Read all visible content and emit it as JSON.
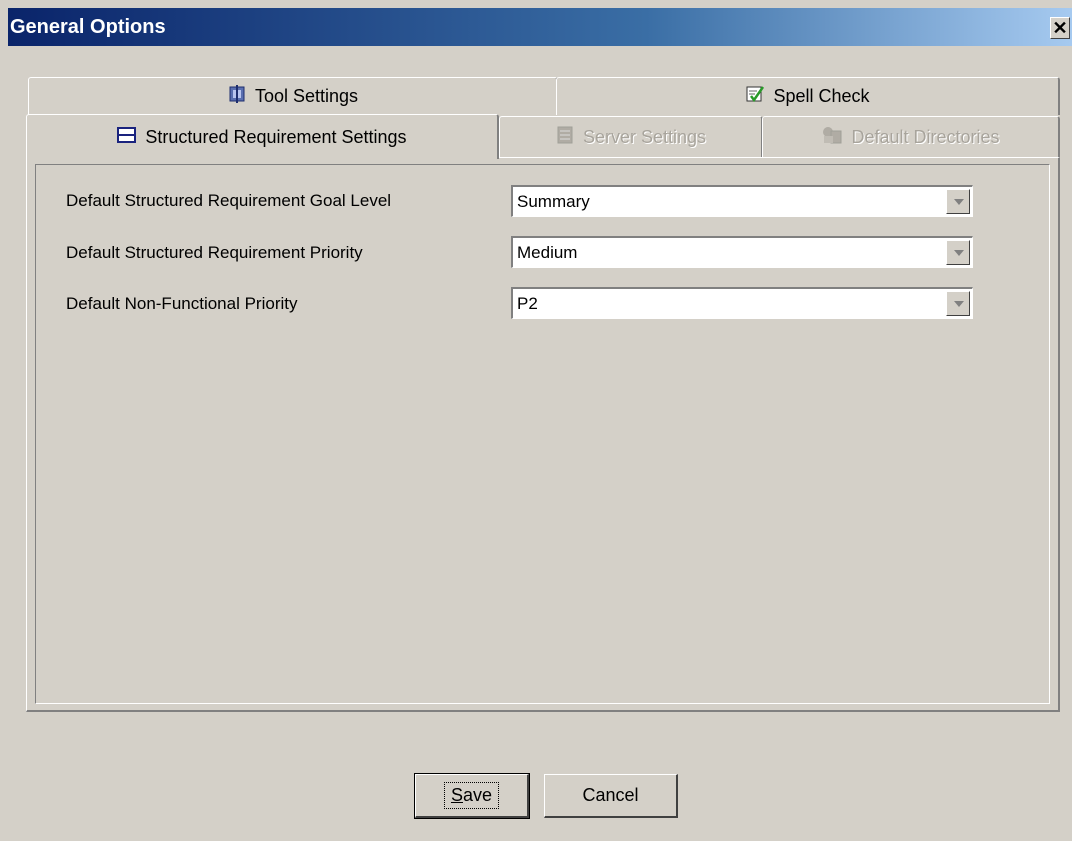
{
  "window": {
    "title": "General Options",
    "close_label": "✕"
  },
  "tabs": {
    "row1": [
      {
        "label": "Tool Settings",
        "icon": "tool-settings-icon",
        "enabled": true
      },
      {
        "label": "Spell Check",
        "icon": "spell-check-icon",
        "enabled": true
      }
    ],
    "row2": [
      {
        "label": "Structured Requirement Settings",
        "icon": "structured-requirement-icon",
        "enabled": true,
        "selected": true
      },
      {
        "label": "Server Settings",
        "icon": "server-icon",
        "enabled": false
      },
      {
        "label": "Default Directories",
        "icon": "directories-icon",
        "enabled": false
      }
    ]
  },
  "form": {
    "fields": [
      {
        "label": "Default Structured Requirement Goal Level",
        "value": "Summary"
      },
      {
        "label": "Default Structured Requirement Priority",
        "value": "Medium"
      },
      {
        "label": "Default Non-Functional Priority",
        "value": "P2"
      }
    ]
  },
  "buttons": {
    "save_mnemonic": "S",
    "save_rest": "ave",
    "cancel": "Cancel"
  },
  "colors": {
    "titlebar_start": "#0a246a",
    "titlebar_end": "#a6caf0",
    "dialog_bg": "#d4d0c8"
  }
}
